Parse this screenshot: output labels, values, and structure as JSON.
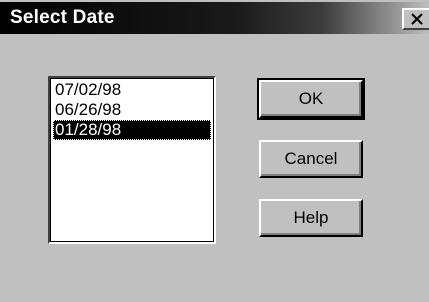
{
  "window": {
    "title": "Select Date",
    "close_glyph": "✕"
  },
  "date_list": {
    "items": [
      {
        "label": "07/02/98",
        "selected": false
      },
      {
        "label": "06/26/98",
        "selected": false
      },
      {
        "label": "01/28/98",
        "selected": true
      }
    ]
  },
  "buttons": {
    "ok_label": "OK",
    "cancel_label": "Cancel",
    "help_label": "Help"
  }
}
